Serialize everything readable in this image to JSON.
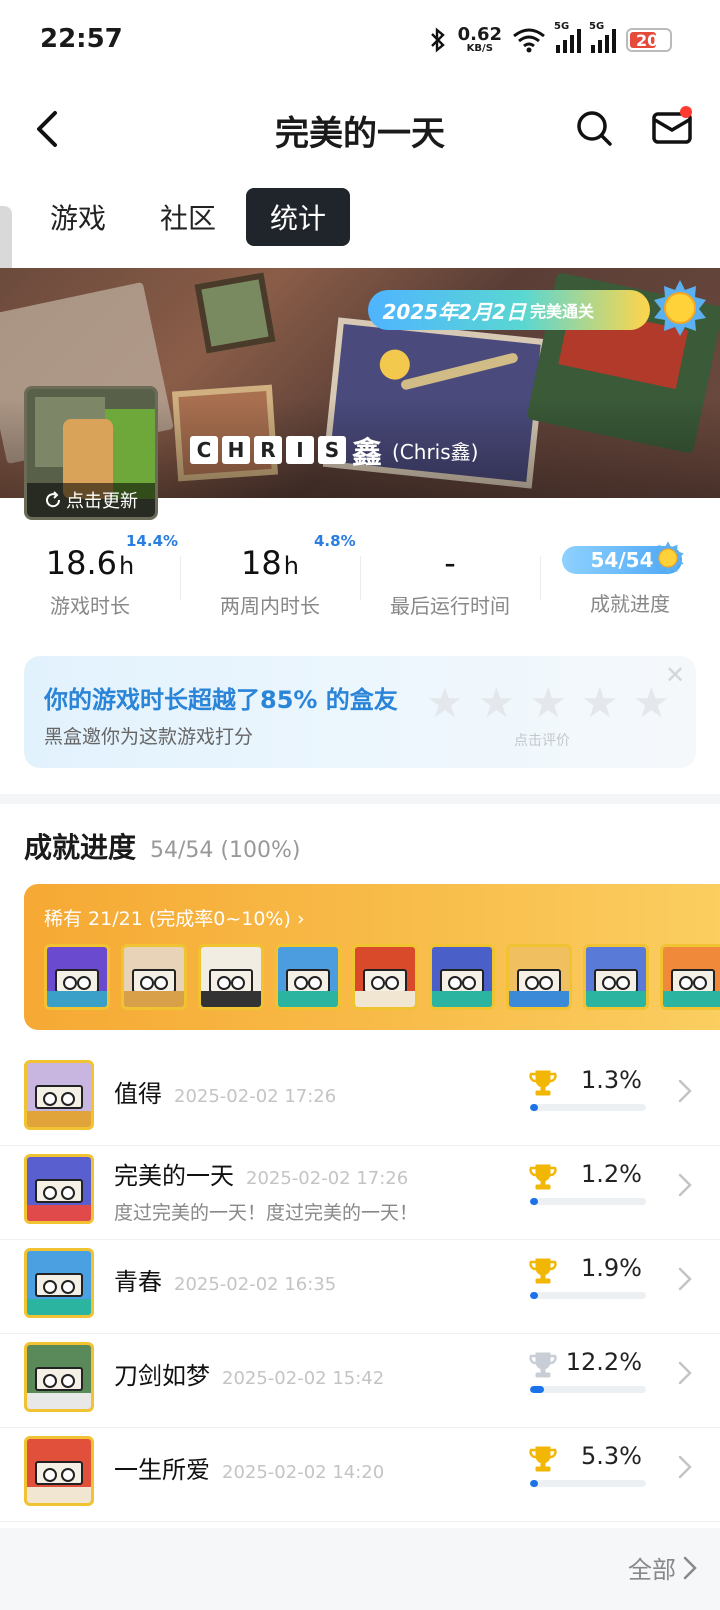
{
  "status_bar": {
    "time": "22:57",
    "net_speed": "0.62",
    "net_unit": "KB/S",
    "sig1_tag": "5G",
    "sig2_tag": "5G",
    "battery": "20"
  },
  "header": {
    "title": "完美的一天",
    "back_icon": "chevron-left-icon",
    "search_icon": "search-icon",
    "mail_icon": "mail-icon"
  },
  "tabs": [
    {
      "label": "游戏",
      "active": false
    },
    {
      "label": "社区",
      "active": false
    },
    {
      "label": "统计",
      "active": true
    }
  ],
  "banner": {
    "clear_date": "2025年2月2日",
    "clear_text": "完美通关",
    "name_letters": [
      "C",
      "H",
      "R",
      "I",
      "S"
    ],
    "name_tail": "鑫",
    "alias": "(Chris鑫)",
    "avatar_refresh": "点击更新"
  },
  "stats": {
    "playtime": {
      "value": "18.6",
      "unit": "h",
      "pct": "14.4%",
      "label": "游戏时长"
    },
    "two_weeks": {
      "value": "18",
      "unit": "h",
      "pct": "4.8%",
      "label": "两周内时长"
    },
    "last_run": {
      "value": "-",
      "label": "最后运行时间"
    },
    "achievement": {
      "value": "54/54",
      "label": "成就进度"
    }
  },
  "rating": {
    "title": "你的游戏时长超越了85% 的盒友",
    "subtitle": "黑盒邀你为这款游戏打分",
    "stars": 5,
    "hint": "点击评价"
  },
  "achievements": {
    "title": "成就进度",
    "summary": "54/54 (100%)",
    "rare_label": "稀有 21/21 (完成率0~10%) ›",
    "rare_icons": [
      {
        "bg": "#6a4bd0",
        "base": "#3aa0c8"
      },
      {
        "bg": "#e8d2b8",
        "base": "#d9a04a"
      },
      {
        "bg": "#f2ede3",
        "base": "#333333"
      },
      {
        "bg": "#4b9de0",
        "base": "#2bb5a0"
      },
      {
        "bg": "#d84a2a",
        "base": "#f0e6d2"
      },
      {
        "bg": "#4a5fc8",
        "base": "#2bb5a0"
      },
      {
        "bg": "#f0c060",
        "base": "#3a8ad8"
      },
      {
        "bg": "#5a7ad8",
        "base": "#2bb5a0"
      },
      {
        "bg": "#f08a3a",
        "base": "#2bb5a0"
      }
    ],
    "items": [
      {
        "name": "值得",
        "time": "2025-02-02 17:26",
        "desc": "",
        "pct": "1.3%",
        "progress": 0.013,
        "trophy": "#f2b705",
        "bg": "#c9b6e0",
        "base": "#e0a43a"
      },
      {
        "name": "完美的一天",
        "time": "2025-02-02 17:26",
        "desc": "度过完美的一天！度过完美的一天！",
        "pct": "1.2%",
        "progress": 0.012,
        "trophy": "#f2b705",
        "bg": "#5a5fd0",
        "base": "#e04a4a"
      },
      {
        "name": "青春",
        "time": "2025-02-02 16:35",
        "desc": "",
        "pct": "1.9%",
        "progress": 0.019,
        "trophy": "#f2b705",
        "bg": "#4aa0e0",
        "base": "#2bb5a0"
      },
      {
        "name": "刀剑如梦",
        "time": "2025-02-02 15:42",
        "desc": "",
        "pct": "12.2%",
        "progress": 0.122,
        "trophy": "#c8ced6",
        "bg": "#5a8a5a",
        "base": "#e8e8e8"
      },
      {
        "name": "一生所爱",
        "time": "2025-02-02 14:20",
        "desc": "",
        "pct": "5.3%",
        "progress": 0.053,
        "trophy": "#f2b705",
        "bg": "#e0503a",
        "base": "#f0e6d2"
      }
    ],
    "all_label": "全部"
  }
}
